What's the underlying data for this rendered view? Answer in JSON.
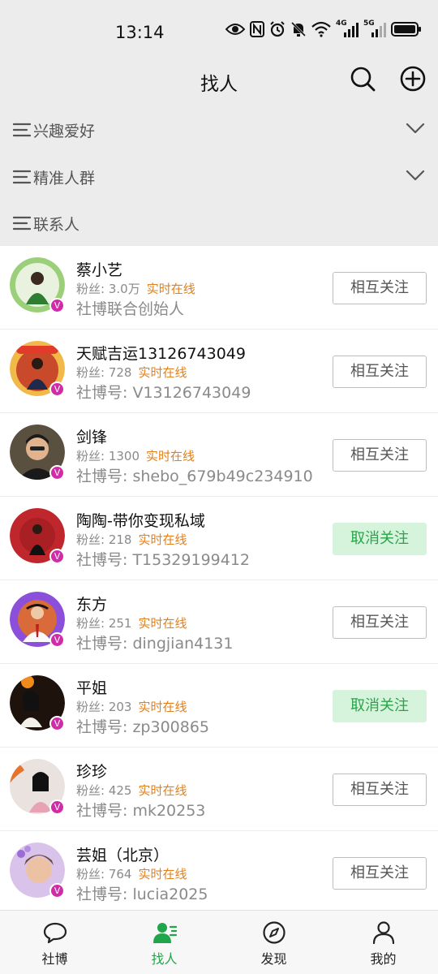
{
  "status_bar": {
    "time": "13:14",
    "network_a": "4G",
    "network_b": "5G"
  },
  "header": {
    "title": "找人",
    "search_icon": "search-icon",
    "add_icon": "plus-circle-icon"
  },
  "filters": [
    {
      "label": "兴趣爱好",
      "expandable": true
    },
    {
      "label": "精准人群",
      "expandable": true
    },
    {
      "label": "联系人",
      "expandable": false
    }
  ],
  "users": [
    {
      "name": "蔡小艺",
      "fans_label": "粉丝:",
      "fans": "3.0万",
      "online": "实时在线",
      "sub": "社博联合创始人",
      "button": "相互关注",
      "button_state": "mutual",
      "avatar_color": "#6aa84f"
    },
    {
      "name": "天赋吉运13126743049",
      "fans_label": "粉丝:",
      "fans": "728",
      "online": "实时在线",
      "sub": "社博号:  V13126743049",
      "button": "相互关注",
      "button_state": "mutual",
      "avatar_color": "#e8a33a"
    },
    {
      "name": "剑锋",
      "fans_label": "粉丝:",
      "fans": "1300",
      "online": "实时在线",
      "sub": "社博号:  shebo_679b49c234910",
      "button": "相互关注",
      "button_state": "mutual",
      "avatar_color": "#3a3a3a"
    },
    {
      "name": "陶陶-带你变现私域",
      "fans_label": "粉丝:",
      "fans": "218",
      "online": "实时在线",
      "sub": "社博号:  T15329199412",
      "button": "取消关注",
      "button_state": "following",
      "avatar_color": "#c0272d"
    },
    {
      "name": "东方",
      "fans_label": "粉丝:",
      "fans": "251",
      "online": "实时在线",
      "sub": "社博号:  dingjian4131",
      "button": "相互关注",
      "button_state": "mutual",
      "avatar_color": "#7a3fc4"
    },
    {
      "name": "平姐",
      "fans_label": "粉丝:",
      "fans": "203",
      "online": "实时在线",
      "sub": "社博号:  zp300865",
      "button": "取消关注",
      "button_state": "following",
      "avatar_color": "#2b1a12"
    },
    {
      "name": "珍珍",
      "fans_label": "粉丝:",
      "fans": "425",
      "online": "实时在线",
      "sub": "社博号:  mk20253",
      "button": "相互关注",
      "button_state": "mutual",
      "avatar_color": "#d9c9c4"
    },
    {
      "name": "芸姐（北京）",
      "fans_label": "粉丝:",
      "fans": "764",
      "online": "实时在线",
      "sub": "社博号:  lucia2025",
      "button": "相互关注",
      "button_state": "mutual",
      "avatar_color": "#b88fd6"
    }
  ],
  "verified_badge": "V",
  "tabs": [
    {
      "label": "社博",
      "icon": "chat-bubble-icon",
      "active": false
    },
    {
      "label": "找人",
      "icon": "find-people-icon",
      "active": true
    },
    {
      "label": "发现",
      "icon": "compass-icon",
      "active": false
    },
    {
      "label": "我的",
      "icon": "person-icon",
      "active": false
    }
  ],
  "colors": {
    "accent_green": "#1fa64a",
    "online_orange": "#e0801f",
    "unfollow_bg": "#d6f3dc",
    "verified_purple": "#d02ca8"
  }
}
